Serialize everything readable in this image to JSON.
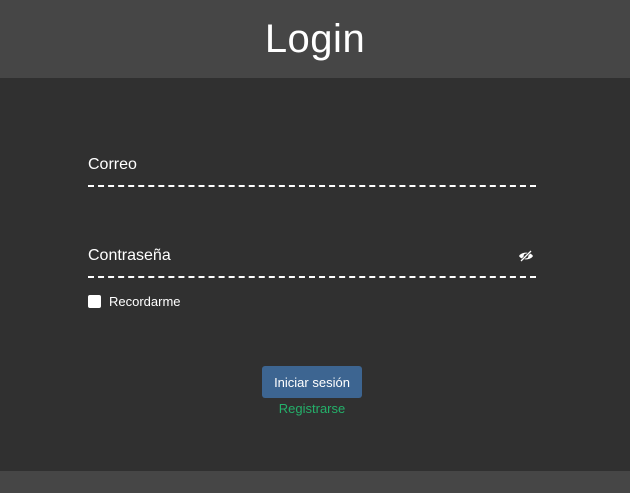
{
  "header": {
    "title": "Login"
  },
  "form": {
    "email": {
      "label": "Correo",
      "value": ""
    },
    "password": {
      "label": "Contraseña",
      "value": "",
      "toggle_icon": "eye-slash-icon"
    },
    "remember": {
      "label": "Recordarme",
      "checked": false
    },
    "submit_label": "Iniciar sesión",
    "register_label": "Registrarse"
  },
  "colors": {
    "header_bg": "#464646",
    "page_bg": "#303030",
    "button_bg": "#3d6591",
    "link": "#24b06a"
  }
}
